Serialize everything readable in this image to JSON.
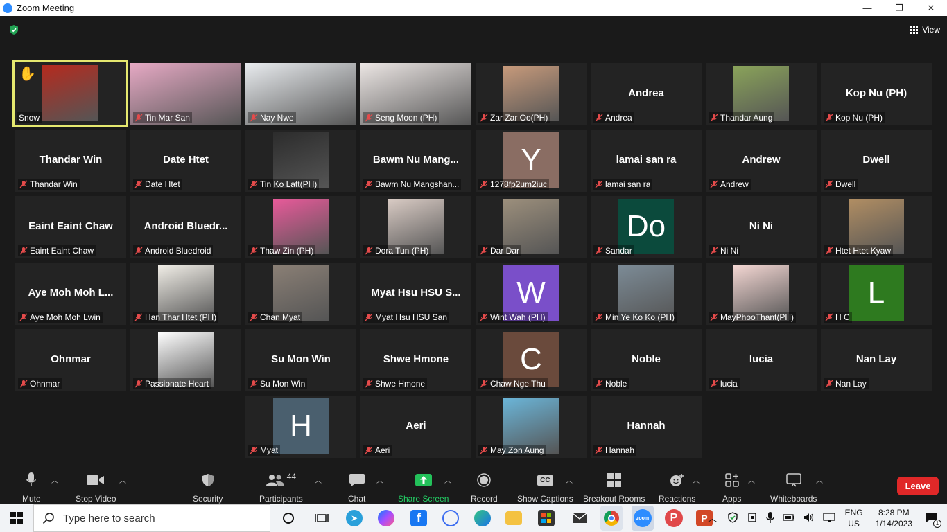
{
  "window": {
    "title": "Zoom Meeting",
    "minimize": "—",
    "maximize": "❐",
    "close": "✕"
  },
  "view": {
    "label": "View"
  },
  "tiles": [
    {
      "name": "Snow",
      "big": "",
      "kind": "photo",
      "color": "#b52a1e",
      "active": true,
      "hand": true
    },
    {
      "name": "Tin Mar San",
      "big": "",
      "kind": "wide",
      "color": "#e6a9c4"
    },
    {
      "name": "Nay Nwe",
      "big": "",
      "kind": "wide",
      "color": "#e9ecef"
    },
    {
      "name": "Seng Moon (PH)",
      "big": "",
      "kind": "wide",
      "color": "#ece6e4"
    },
    {
      "name": "Zar Zar Oo(PH)",
      "big": "",
      "kind": "photo",
      "color": "#c79a7b"
    },
    {
      "name": "Andrea",
      "big": "Andrea",
      "kind": "name"
    },
    {
      "name": "Thandar Aung",
      "big": "",
      "kind": "photo",
      "color": "#8aa35a"
    },
    {
      "name": "Kop Nu (PH)",
      "big": "Kop Nu (PH)",
      "kind": "name"
    },
    {
      "name": "Thandar Win",
      "big": "Thandar Win",
      "kind": "name"
    },
    {
      "name": "Date Htet",
      "big": "Date Htet",
      "kind": "name"
    },
    {
      "name": "Tin Ko Latt(PH)",
      "big": "",
      "kind": "photo",
      "color": "#2c2c2c"
    },
    {
      "name": "Bawm Nu Mangshan...",
      "big": "Bawm Nu Mang...",
      "kind": "name"
    },
    {
      "name": "1278fp2um2iuc",
      "big": "",
      "kind": "avatar",
      "letter": "Y",
      "color": "#8a6d63"
    },
    {
      "name": "lamai san ra",
      "big": "lamai san ra",
      "kind": "name"
    },
    {
      "name": "Andrew",
      "big": "Andrew",
      "kind": "name"
    },
    {
      "name": "Dwell",
      "big": "Dwell",
      "kind": "name"
    },
    {
      "name": "Eaint Eaint Chaw",
      "big": "Eaint Eaint Chaw",
      "kind": "name"
    },
    {
      "name": "Android Bluedroid",
      "big": "Android Bluedr...",
      "kind": "name"
    },
    {
      "name": "Thaw Zin (PH)",
      "big": "",
      "kind": "photo",
      "color": "#e85a9a"
    },
    {
      "name": "Dora Tun (PH)",
      "big": "",
      "kind": "photo",
      "color": "#d9cbc4"
    },
    {
      "name": "Dar Dar",
      "big": "",
      "kind": "photo",
      "color": "#9c8f7c"
    },
    {
      "name": "Sandar",
      "big": "",
      "kind": "avatar",
      "letter": "Do",
      "color": "#0b4a3c"
    },
    {
      "name": "Ni Ni",
      "big": "Ni Ni",
      "kind": "name"
    },
    {
      "name": "Htet Htet Kyaw",
      "big": "",
      "kind": "photo",
      "color": "#b18e63"
    },
    {
      "name": "Aye Moh Moh Lwin",
      "big": "Aye Moh Moh L...",
      "kind": "name"
    },
    {
      "name": "Han Thar Htet (PH)",
      "big": "",
      "kind": "photo",
      "color": "#f0ede6"
    },
    {
      "name": "Chan Myat",
      "big": "",
      "kind": "photo",
      "color": "#8a7f75"
    },
    {
      "name": "Myat Hsu HSU San",
      "big": "Myat Hsu HSU S...",
      "kind": "name"
    },
    {
      "name": "Wint Wah (PH)",
      "big": "",
      "kind": "avatar",
      "letter": "W",
      "color": "#7a4fc9"
    },
    {
      "name": "Min Ye Ko Ko (PH)",
      "big": "",
      "kind": "photo",
      "color": "#7c8b96"
    },
    {
      "name": "MayPhooThant(PH)",
      "big": "",
      "kind": "photo",
      "color": "#f3d6d2"
    },
    {
      "name": "H C",
      "big": "",
      "kind": "avatar",
      "letter": "L",
      "color": "#2e7a1f"
    },
    {
      "name": "Ohnmar",
      "big": "Ohnmar",
      "kind": "name"
    },
    {
      "name": "Passionate Heart",
      "big": "",
      "kind": "photo",
      "color": "#ffffff"
    },
    {
      "name": "Su Mon Win",
      "big": "Su Mon Win",
      "kind": "name"
    },
    {
      "name": "Shwe Hmone",
      "big": "Shwe Hmone",
      "kind": "name"
    },
    {
      "name": "Chaw Nge Thu",
      "big": "",
      "kind": "avatar",
      "letter": "C",
      "color": "#6a4a3c"
    },
    {
      "name": "Noble",
      "big": "Noble",
      "kind": "name"
    },
    {
      "name": "lucia",
      "big": "lucia",
      "kind": "name"
    },
    {
      "name": "Nan Lay",
      "big": "Nan Lay",
      "kind": "name"
    },
    {
      "name": "Myat",
      "big": "",
      "kind": "avatar",
      "letter": "H",
      "color": "#4a5f6e"
    },
    {
      "name": "Aeri",
      "big": "Aeri",
      "kind": "name"
    },
    {
      "name": "May Zon Aung",
      "big": "",
      "kind": "photo",
      "color": "#6bb5d8"
    },
    {
      "name": "Hannah",
      "big": "Hannah",
      "kind": "name"
    }
  ],
  "toolbar": {
    "mute": "Mute",
    "stop_video": "Stop Video",
    "security": "Security",
    "participants": "Participants",
    "participants_count": "44",
    "chat": "Chat",
    "share_screen": "Share Screen",
    "record": "Record",
    "show_captions": "Show Captions",
    "cc": "CC",
    "breakout_rooms": "Breakout Rooms",
    "reactions": "Reactions",
    "apps": "Apps",
    "whiteboards": "Whiteboards",
    "leave": "Leave"
  },
  "taskbar": {
    "search_placeholder": "Type here to search",
    "lang_top": "ENG",
    "lang_bottom": "US",
    "time": "8:28 PM",
    "date": "1/14/2023",
    "notif_count": "1"
  }
}
